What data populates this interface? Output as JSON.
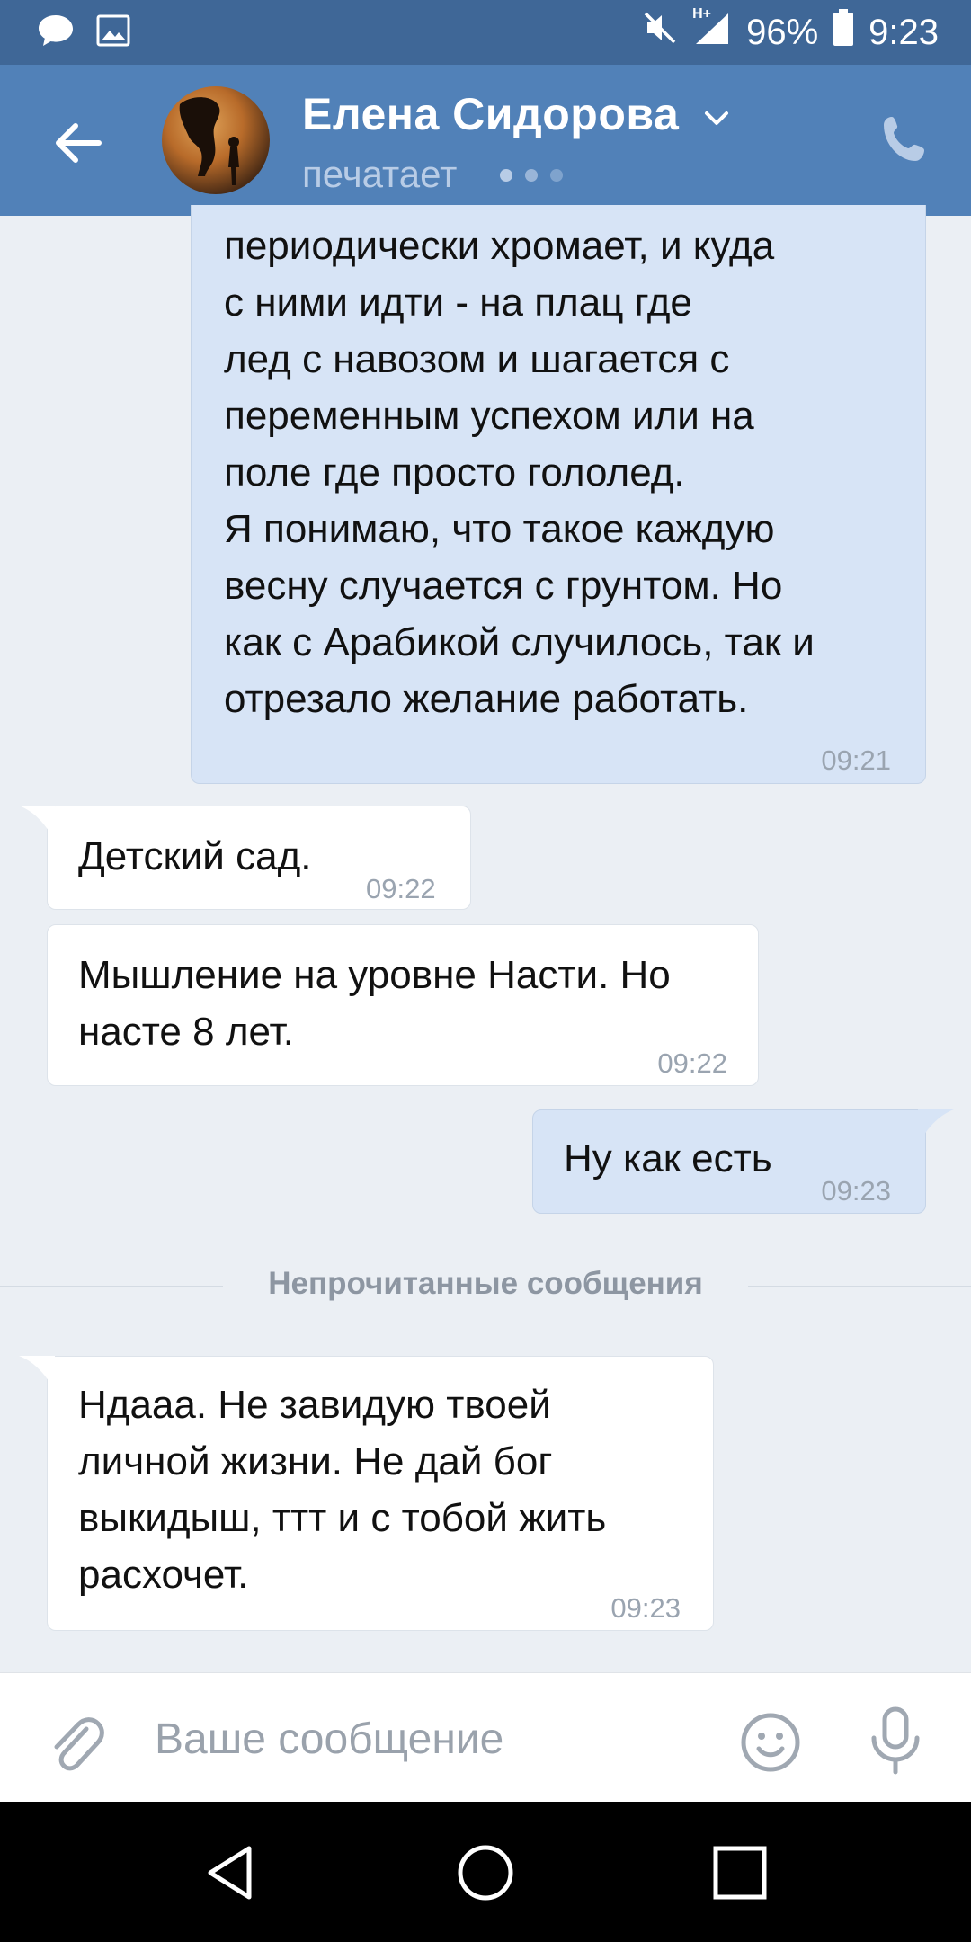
{
  "status_bar": {
    "battery_percent": "96%",
    "time": "9:23",
    "network_label": "H+",
    "icons": [
      "message-notification-icon",
      "image-notification-icon",
      "muted-icon",
      "signal-icon",
      "battery-icon"
    ]
  },
  "header": {
    "contact_name": "Елена Сидорова",
    "status_text": "печатает",
    "icons": [
      "back-arrow-icon",
      "chevron-down-icon",
      "phone-icon"
    ]
  },
  "messages": [
    {
      "direction": "out",
      "text": "периодически хромает, и куда\nс ними идти - на плац где\nлед с навозом и шагается с\nпеременным успехом или на\nполе где просто гололед.\nЯ понимаю, что такое каждую\nвесну случается с грунтом. Но\nкак с Арабикой случилось, так и\nотрезало желание работать.",
      "time": "09:21"
    },
    {
      "direction": "in",
      "text": "Детский сад.",
      "time": "09:22"
    },
    {
      "direction": "in",
      "text": "Мышление на уровне Насти. Но\nнасте 8 лет.",
      "time": "09:22"
    },
    {
      "direction": "out",
      "text": "Ну как есть",
      "time": "09:23"
    },
    {
      "direction": "in",
      "text": "Ндааа. Не завидую  твоей\nличной жизни. Не дай бог\nвыкидыш, ттт  и с тобой жить\nрасхочет.",
      "time": "09:23"
    }
  ],
  "unread_divider": "Непрочитанные сообщения",
  "composer": {
    "placeholder": "Ваше сообщение",
    "icons": [
      "paperclip-icon",
      "emoji-icon",
      "microphone-icon"
    ]
  },
  "nav_bar": {
    "icons": [
      "nav-back-icon",
      "nav-home-icon",
      "nav-recent-icon"
    ]
  },
  "colors": {
    "status_bar": "#3f6797",
    "header": "#5181b8",
    "chat_background": "#ebeff4",
    "outgoing_bubble": "#d7e4f6",
    "incoming_bubble": "#ffffff"
  }
}
